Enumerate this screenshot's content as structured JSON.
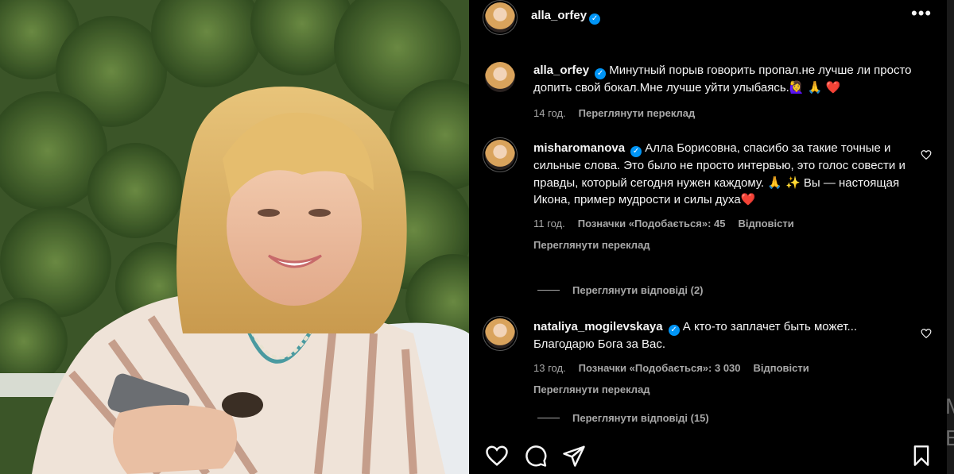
{
  "post": {
    "author": "alla_orfey"
  },
  "caption": {
    "username": "alla_orfey",
    "text": "Минутный порыв говорить пропал.не лучше ли просто допить свой бокал.Мне лучше уйти улыбаясь.🙋‍♀️ 🙏 ❤️",
    "time": "14 год.",
    "translate": "Переглянути переклад"
  },
  "comments": [
    {
      "username": "misharomanova",
      "text": "Алла Борисовна, спасибо за такие точные и сильные слова. Это было не просто интервью, это голос совести и правды, который сегодня нужен каждому. 🙏 ✨ Вы — настоящая Икона, пример мудрости и силы духа❤️",
      "time": "11 год.",
      "likes": "Позначки «Подобається»: 45",
      "reply": "Відповісти",
      "translate": "Переглянути переклад",
      "view_replies": "Переглянути відповіді (2)"
    },
    {
      "username": "nataliya_mogilevskaya",
      "text": "А кто-то заплачет быть может... Благодарю Бога за Вас.",
      "time": "13 год.",
      "likes": "Позначки «Подобається»: 3 030",
      "reply": "Відповісти",
      "translate": "Переглянути переклад",
      "view_replies": "Переглянути відповіді (15)"
    }
  ],
  "icons": {
    "more": "more-options-icon",
    "like": "heart-icon",
    "comment": "comment-icon",
    "share": "share-icon",
    "save": "bookmark-icon",
    "verified": "verified-badge-icon"
  },
  "colors": {
    "background": "#000000",
    "text_primary": "#f5f5f5",
    "text_secondary": "#a8a8a8",
    "verified": "#0095f6"
  },
  "overflow_letters": "M E"
}
